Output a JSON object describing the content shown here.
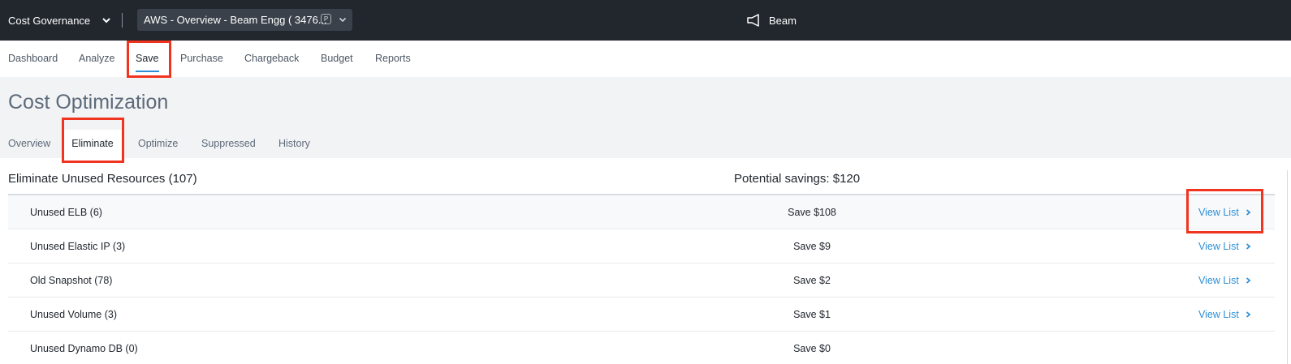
{
  "topbar": {
    "app_name": "Cost Governance",
    "account_label": "AWS  - Overview - Beam Engg ( 3476...",
    "account_badge": "P",
    "product_name": "Beam"
  },
  "nav": {
    "items": [
      {
        "label": "Dashboard"
      },
      {
        "label": "Analyze"
      },
      {
        "label": "Save",
        "active": true
      },
      {
        "label": "Purchase"
      },
      {
        "label": "Chargeback"
      },
      {
        "label": "Budget"
      },
      {
        "label": "Reports"
      }
    ]
  },
  "page": {
    "title": "Cost Optimization",
    "tabs": [
      {
        "label": "Overview"
      },
      {
        "label": "Eliminate",
        "active": true
      },
      {
        "label": "Optimize"
      },
      {
        "label": "Suppressed"
      },
      {
        "label": "History"
      }
    ]
  },
  "section": {
    "title": "Eliminate Unused Resources (107)",
    "savings": "Potential savings: $120",
    "rows": [
      {
        "name": "Unused ELB (6)",
        "save": "Save $108",
        "action": "View List"
      },
      {
        "name": "Unused Elastic IP (3)",
        "save": "Save $9",
        "action": "View List"
      },
      {
        "name": "Old Snapshot (78)",
        "save": "Save $2",
        "action": "View List"
      },
      {
        "name": "Unused Volume (3)",
        "save": "Save $1",
        "action": "View List"
      },
      {
        "name": "Unused Dynamo DB (0)",
        "save": "Save $0"
      }
    ]
  },
  "colors": {
    "topbar": "#22272e",
    "accent": "#2f8fd6",
    "highlight_box": "#f0341f"
  }
}
